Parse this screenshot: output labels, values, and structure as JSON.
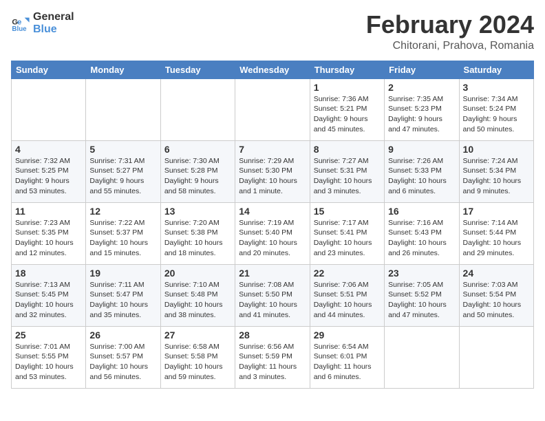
{
  "header": {
    "logo_line1": "General",
    "logo_line2": "Blue",
    "title": "February 2024",
    "subtitle": "Chitorani, Prahova, Romania"
  },
  "days_of_week": [
    "Sunday",
    "Monday",
    "Tuesday",
    "Wednesday",
    "Thursday",
    "Friday",
    "Saturday"
  ],
  "weeks": [
    [
      {
        "day": "",
        "info": ""
      },
      {
        "day": "",
        "info": ""
      },
      {
        "day": "",
        "info": ""
      },
      {
        "day": "",
        "info": ""
      },
      {
        "day": "1",
        "info": "Sunrise: 7:36 AM\nSunset: 5:21 PM\nDaylight: 9 hours\nand 45 minutes."
      },
      {
        "day": "2",
        "info": "Sunrise: 7:35 AM\nSunset: 5:23 PM\nDaylight: 9 hours\nand 47 minutes."
      },
      {
        "day": "3",
        "info": "Sunrise: 7:34 AM\nSunset: 5:24 PM\nDaylight: 9 hours\nand 50 minutes."
      }
    ],
    [
      {
        "day": "4",
        "info": "Sunrise: 7:32 AM\nSunset: 5:25 PM\nDaylight: 9 hours\nand 53 minutes."
      },
      {
        "day": "5",
        "info": "Sunrise: 7:31 AM\nSunset: 5:27 PM\nDaylight: 9 hours\nand 55 minutes."
      },
      {
        "day": "6",
        "info": "Sunrise: 7:30 AM\nSunset: 5:28 PM\nDaylight: 9 hours\nand 58 minutes."
      },
      {
        "day": "7",
        "info": "Sunrise: 7:29 AM\nSunset: 5:30 PM\nDaylight: 10 hours\nand 1 minute."
      },
      {
        "day": "8",
        "info": "Sunrise: 7:27 AM\nSunset: 5:31 PM\nDaylight: 10 hours\nand 3 minutes."
      },
      {
        "day": "9",
        "info": "Sunrise: 7:26 AM\nSunset: 5:33 PM\nDaylight: 10 hours\nand 6 minutes."
      },
      {
        "day": "10",
        "info": "Sunrise: 7:24 AM\nSunset: 5:34 PM\nDaylight: 10 hours\nand 9 minutes."
      }
    ],
    [
      {
        "day": "11",
        "info": "Sunrise: 7:23 AM\nSunset: 5:35 PM\nDaylight: 10 hours\nand 12 minutes."
      },
      {
        "day": "12",
        "info": "Sunrise: 7:22 AM\nSunset: 5:37 PM\nDaylight: 10 hours\nand 15 minutes."
      },
      {
        "day": "13",
        "info": "Sunrise: 7:20 AM\nSunset: 5:38 PM\nDaylight: 10 hours\nand 18 minutes."
      },
      {
        "day": "14",
        "info": "Sunrise: 7:19 AM\nSunset: 5:40 PM\nDaylight: 10 hours\nand 20 minutes."
      },
      {
        "day": "15",
        "info": "Sunrise: 7:17 AM\nSunset: 5:41 PM\nDaylight: 10 hours\nand 23 minutes."
      },
      {
        "day": "16",
        "info": "Sunrise: 7:16 AM\nSunset: 5:43 PM\nDaylight: 10 hours\nand 26 minutes."
      },
      {
        "day": "17",
        "info": "Sunrise: 7:14 AM\nSunset: 5:44 PM\nDaylight: 10 hours\nand 29 minutes."
      }
    ],
    [
      {
        "day": "18",
        "info": "Sunrise: 7:13 AM\nSunset: 5:45 PM\nDaylight: 10 hours\nand 32 minutes."
      },
      {
        "day": "19",
        "info": "Sunrise: 7:11 AM\nSunset: 5:47 PM\nDaylight: 10 hours\nand 35 minutes."
      },
      {
        "day": "20",
        "info": "Sunrise: 7:10 AM\nSunset: 5:48 PM\nDaylight: 10 hours\nand 38 minutes."
      },
      {
        "day": "21",
        "info": "Sunrise: 7:08 AM\nSunset: 5:50 PM\nDaylight: 10 hours\nand 41 minutes."
      },
      {
        "day": "22",
        "info": "Sunrise: 7:06 AM\nSunset: 5:51 PM\nDaylight: 10 hours\nand 44 minutes."
      },
      {
        "day": "23",
        "info": "Sunrise: 7:05 AM\nSunset: 5:52 PM\nDaylight: 10 hours\nand 47 minutes."
      },
      {
        "day": "24",
        "info": "Sunrise: 7:03 AM\nSunset: 5:54 PM\nDaylight: 10 hours\nand 50 minutes."
      }
    ],
    [
      {
        "day": "25",
        "info": "Sunrise: 7:01 AM\nSunset: 5:55 PM\nDaylight: 10 hours\nand 53 minutes."
      },
      {
        "day": "26",
        "info": "Sunrise: 7:00 AM\nSunset: 5:57 PM\nDaylight: 10 hours\nand 56 minutes."
      },
      {
        "day": "27",
        "info": "Sunrise: 6:58 AM\nSunset: 5:58 PM\nDaylight: 10 hours\nand 59 minutes."
      },
      {
        "day": "28",
        "info": "Sunrise: 6:56 AM\nSunset: 5:59 PM\nDaylight: 11 hours\nand 3 minutes."
      },
      {
        "day": "29",
        "info": "Sunrise: 6:54 AM\nSunset: 6:01 PM\nDaylight: 11 hours\nand 6 minutes."
      },
      {
        "day": "",
        "info": ""
      },
      {
        "day": "",
        "info": ""
      }
    ]
  ]
}
